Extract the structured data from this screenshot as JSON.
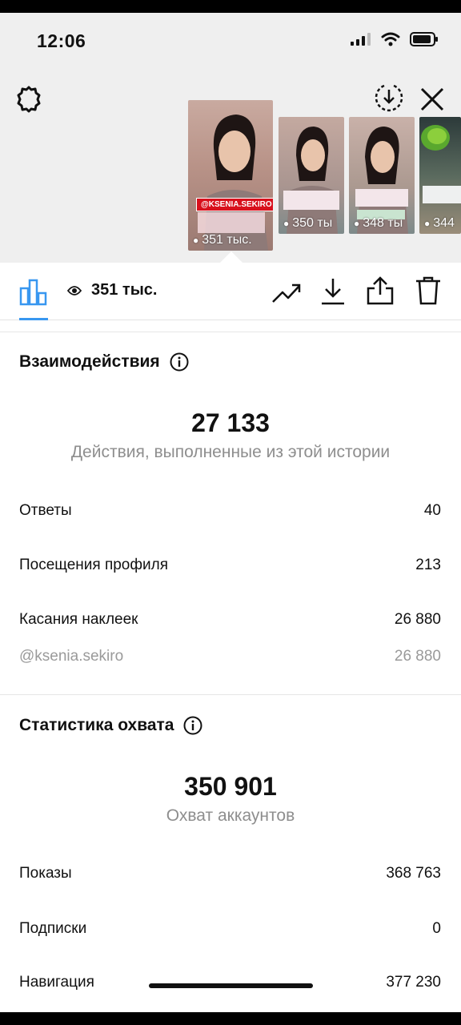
{
  "status_bar": {
    "time": "12:06"
  },
  "stories": [
    {
      "views": "351 тыс.",
      "sticker": "@KSENIA.SEKIRO"
    },
    {
      "views": "350 ты"
    },
    {
      "views": "348 ты"
    },
    {
      "views": "344"
    }
  ],
  "toolbar": {
    "views": "351 тыс."
  },
  "interactions": {
    "title": "Взаимодействия",
    "total": "27 133",
    "total_label": "Действия, выполненные из этой истории",
    "rows": [
      {
        "label": "Ответы",
        "value": "40"
      },
      {
        "label": "Посещения профиля",
        "value": "213"
      },
      {
        "label": "Касания наклеек",
        "value": "26 880"
      },
      {
        "label": "@ksenia.sekiro",
        "value": "26 880"
      }
    ]
  },
  "reach": {
    "title": "Статистика охвата",
    "total": "350 901",
    "total_label": "Охват аккаунтов",
    "rows": [
      {
        "label": "Показы",
        "value": "368 763"
      },
      {
        "label": "Подписки",
        "value": "0"
      },
      {
        "label": "Навигация",
        "value": "377 230"
      }
    ]
  },
  "colors": {
    "accent": "#3897f0",
    "sticker_red": "#d8101c"
  }
}
